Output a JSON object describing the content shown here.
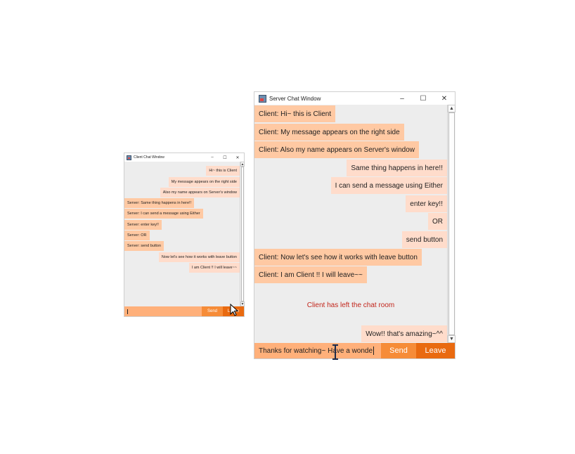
{
  "client_window": {
    "title": "Client Chat Window",
    "controls": {
      "minimize": "–",
      "maximize": "☐",
      "close": "✕"
    },
    "scroll": {
      "up": "▲",
      "down": "▼"
    },
    "messages": [
      {
        "side": "right",
        "text": "Hi~ this is Client"
      },
      {
        "side": "right",
        "text": "My message appears on the right side"
      },
      {
        "side": "right",
        "text": "Also my name appears on Server's window"
      },
      {
        "side": "left",
        "text": "Server: Same thing happens in here!!"
      },
      {
        "side": "left",
        "text": "Server: I can send a message using Either"
      },
      {
        "side": "left",
        "text": "Server: enter key!!"
      },
      {
        "side": "left",
        "text": "Server: OR"
      },
      {
        "side": "left",
        "text": "Server: send button"
      },
      {
        "side": "right",
        "text": "Now let's see how it works with leave button"
      },
      {
        "side": "right",
        "text": "I am Client !! I will leave~~"
      }
    ],
    "input": {
      "value": ""
    },
    "send_label": "Send",
    "leave_label": "Leave"
  },
  "server_window": {
    "title": "Server Chat Window",
    "controls": {
      "minimize": "–",
      "maximize": "☐",
      "close": "✕"
    },
    "scroll": {
      "up": "▲",
      "down": "▼"
    },
    "messages": [
      {
        "side": "left",
        "text": "Client: Hi~ this is Client"
      },
      {
        "side": "left",
        "text": "Client: My message appears on the right side"
      },
      {
        "side": "left",
        "text": "Client: Also my name appears on Server's window"
      },
      {
        "side": "right",
        "text": "Same thing happens in here!!"
      },
      {
        "side": "right",
        "text": "I can send a message using Either"
      },
      {
        "side": "right",
        "text": "enter key!!"
      },
      {
        "side": "right",
        "text": "OR"
      },
      {
        "side": "right",
        "text": "send button"
      },
      {
        "side": "left",
        "text": "Client: Now let's see how it works with leave button"
      },
      {
        "side": "left",
        "text": "Client: I am Client !! I will leave~~"
      },
      {
        "side": "center",
        "text": "Client has left the chat room",
        "kind": "notice"
      },
      {
        "side": "right",
        "text": "Wow!! that's amazing~^^"
      }
    ],
    "input": {
      "value": "Thanks for watching~ Have a wonde"
    },
    "send_label": "Send",
    "leave_label": "Leave"
  },
  "colors": {
    "left_bubble": "#ffc9a3",
    "right_bubble": "#ffdccb",
    "input_bg": "#ffb07a",
    "send_button": "#f68c38",
    "leave_button": "#e96a10",
    "notice_text": "#c2261c",
    "chat_bg": "#ededed"
  }
}
